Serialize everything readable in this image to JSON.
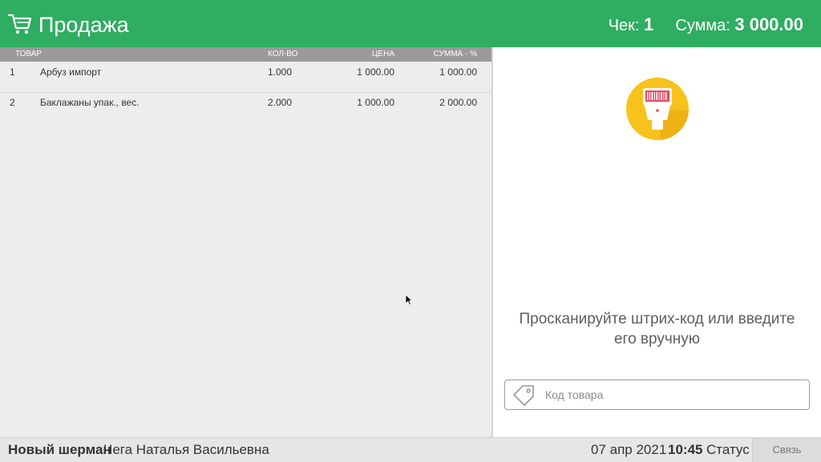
{
  "header": {
    "title": "Продажа",
    "receipt_label": "Чек:",
    "receipt_number": "1",
    "sum_label": "Сумма:",
    "sum_value": "3 000.00",
    "icon": "cart-icon",
    "background": "#2fad61"
  },
  "table": {
    "columns": {
      "name": "ТОВАР",
      "qty": "КОЛ-ВО",
      "price": "ЦЕНА",
      "sum": "СУММА - %"
    },
    "rows": [
      {
        "num": "1",
        "name": "Арбуз импорт",
        "qty": "1.000",
        "price": "1 000.00",
        "sum": "1 000.00"
      },
      {
        "num": "2",
        "name": "Баклажаны упак., вес.",
        "qty": "2.000",
        "price": "1 000.00",
        "sum": "2 000.00"
      }
    ]
  },
  "scan": {
    "icon": "barcode-scanner-icon",
    "prompt": "Просканируйте штрих-код или введите его вручную",
    "input_placeholder": "Код товара",
    "input_value": "",
    "input_icon": "tag-icon"
  },
  "footer": {
    "store": "Новый шерман",
    "cashier": "Чега Наталья Васильевна",
    "date": "07 апр 2021",
    "time": "10:45",
    "status": "Статус",
    "link_label": "Связь"
  }
}
